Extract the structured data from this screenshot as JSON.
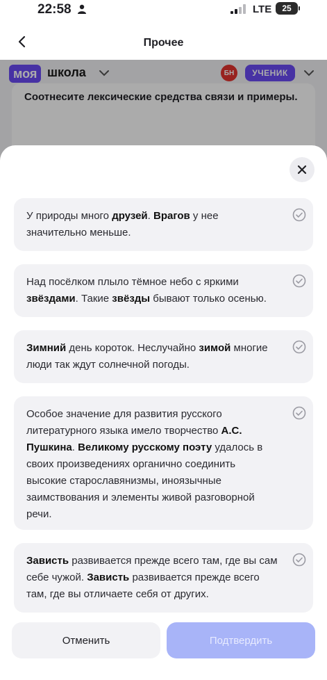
{
  "status": {
    "time": "22:58",
    "network": "LTE",
    "battery": "25"
  },
  "nav": {
    "title": "Прочее"
  },
  "app": {
    "logo_part1": "моя",
    "logo_part2": "школа",
    "avatar": "БН",
    "role": "УЧЕНИК"
  },
  "task": {
    "text": "Соотнесите лексические средства связи и примеры."
  },
  "options": [
    {
      "segments": [
        {
          "t": "У природы много ",
          "b": false
        },
        {
          "t": "друзей",
          "b": true
        },
        {
          "t": ". ",
          "b": false
        },
        {
          "t": "Врагов",
          "b": true
        },
        {
          "t": " у нее значительно меньше.",
          "b": false
        }
      ]
    },
    {
      "segments": [
        {
          "t": "Над посёлком плыло тёмное небо с яркими ",
          "b": false
        },
        {
          "t": "звёздами",
          "b": true
        },
        {
          "t": ". Такие ",
          "b": false
        },
        {
          "t": "звёзды",
          "b": true
        },
        {
          "t": " бывают только осенью.",
          "b": false
        }
      ]
    },
    {
      "segments": [
        {
          "t": "Зимний",
          "b": true
        },
        {
          "t": " день короток. Неслучайно ",
          "b": false
        },
        {
          "t": "зимой",
          "b": true
        },
        {
          "t": " многие люди так ждут солнечной погоды.",
          "b": false
        }
      ]
    },
    {
      "segments": [
        {
          "t": "Особое значение для развития русского литературного языка имело творчество ",
          "b": false
        },
        {
          "t": "А.С. Пушкина",
          "b": true
        },
        {
          "t": ". ",
          "b": false
        },
        {
          "t": "Великому русскому поэту",
          "b": true
        },
        {
          "t": " удалось в своих произведениях органично соединить высокие старославянизмы, иноязычные заимствования и элементы живой разговорной речи.",
          "b": false
        }
      ]
    },
    {
      "segments": [
        {
          "t": "Зависть",
          "b": true
        },
        {
          "t": " развивается прежде всего там, где вы сам себе чужой. ",
          "b": false
        },
        {
          "t": "Зависть",
          "b": true
        },
        {
          "t": " развивается прежде всего там, где вы отличаете себя от других.",
          "b": false
        }
      ]
    }
  ],
  "buttons": {
    "cancel": "Отменить",
    "confirm": "Подтвердить"
  },
  "colors": {
    "accent": "#6a4bf5",
    "confirm_disabled": "#a8b4f8",
    "avatar": "#e3342f"
  }
}
